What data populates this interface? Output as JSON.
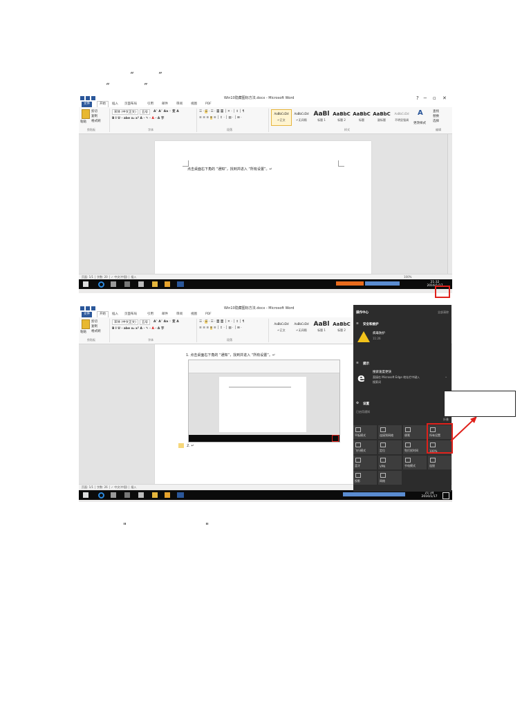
{
  "doc": {
    "line1_quotes": [
      "“",
      "”"
    ],
    "line2_quotes": [
      "“",
      "”"
    ],
    "bottom_quotes": [
      "\"",
      "\""
    ]
  },
  "word": {
    "title": "Win10隐藏图标方法.docx - Microsoft Word",
    "title2": "Win10隐藏图标方法.docx - Microsoft Word",
    "tabs": [
      "文件",
      "开始",
      "插入",
      "页面布局",
      "引用",
      "邮件",
      "审阅",
      "视图",
      "PDF"
    ],
    "clipboard": {
      "cut": "剪切",
      "copy": "复制",
      "paste": "粘贴",
      "painter": "格式刷",
      "label": "剪贴板"
    },
    "font": {
      "name": "宋体 (中文正文)",
      "size": "五号",
      "label": "字体"
    },
    "paragraph_label": "段落",
    "styles_label": "样式",
    "styles": [
      {
        "preview": "AaBbCcDd",
        "name": "↵正文"
      },
      {
        "preview": "AaBbCcDd",
        "name": "↵无间隔"
      },
      {
        "preview": "AaBl",
        "name": "标题 1"
      },
      {
        "preview": "AaBbC",
        "name": "标题 2"
      },
      {
        "preview": "AaBbC",
        "name": "标题"
      },
      {
        "preview": "AaBbC",
        "name": "副标题"
      },
      {
        "preview": "AaBbCcDd",
        "name": "不明显强调"
      }
    ],
    "change_styles": "更改样式",
    "editing": [
      "查找",
      "替换",
      "选择"
    ],
    "editing_label": "编辑",
    "doc_line1": "点击桌面右下角的 “通知”，找到并进入 “所有设置”。↵",
    "doc_line2": "1.  点击桌面右下角的 “通知”，找到并进入 “所有设置”。↵",
    "doc_line3": "2.  ↵",
    "status1": "页面: 1/1  │  字数: 20  │  ✓  中文(中国)  │  插入",
    "status2": "页面: 1/1  │  字数: 26  │  ✓  中文(中国)  │  插入",
    "zoom": "100%",
    "clock1_time": "21:32",
    "clock1_date": "2016/1/17",
    "clock2_time": "21:34",
    "clock2_date": "2016/1/17"
  },
  "action_center": {
    "title": "操作中心",
    "clear_all": "全部清除",
    "security_header": "安全和维护",
    "security_item": "病毒防护",
    "security_time": "11:26",
    "tip_header": "提示",
    "tip_title": "搜索速度更快",
    "tip_body": "直接在 Microsoft Edge 地址栏中键入",
    "tip_sub": "搜索词",
    "settings_header": "设置",
    "settings_sub": "已启用通知",
    "collapse": "折叠",
    "tiles": [
      "平板模式",
      "连接到网络",
      "便笺",
      "所有设置",
      "飞行模式",
      "定位",
      "免打扰时间",
      "100%",
      "蓝牙",
      "VPN",
      "节电模式",
      "连接",
      "投影",
      "网络"
    ]
  }
}
